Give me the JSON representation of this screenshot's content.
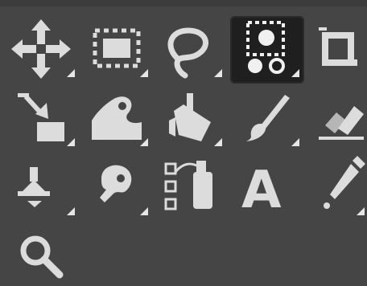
{
  "toolbox": {
    "active_tool": "select-by-color",
    "colors": {
      "background": "#454545",
      "icon": "#dcdcdc",
      "selected_bg": "#1f1f1f"
    },
    "tools": [
      {
        "name": "move",
        "icon": "move-icon",
        "has_group": true
      },
      {
        "name": "rectangle-select",
        "icon": "rectangle-select-icon",
        "has_group": true
      },
      {
        "name": "free-select",
        "icon": "lasso-icon",
        "has_group": true
      },
      {
        "name": "select-by-color",
        "icon": "select-by-color-icon",
        "has_group": true,
        "selected": true
      },
      {
        "name": "crop",
        "icon": "crop-icon",
        "has_group": false
      },
      {
        "name": "unified-transform",
        "icon": "transform-icon",
        "has_group": true
      },
      {
        "name": "warp-transform",
        "icon": "warp-icon",
        "has_group": true
      },
      {
        "name": "bucket-fill",
        "icon": "bucket-fill-icon",
        "has_group": true
      },
      {
        "name": "paintbrush",
        "icon": "paintbrush-icon",
        "has_group": true
      },
      {
        "name": "eraser",
        "icon": "eraser-icon",
        "has_group": true
      },
      {
        "name": "clone",
        "icon": "clone-stamp-icon",
        "has_group": true
      },
      {
        "name": "smudge",
        "icon": "smudge-icon",
        "has_group": true
      },
      {
        "name": "paths",
        "icon": "paths-icon",
        "has_group": false
      },
      {
        "name": "text",
        "icon": "text-icon",
        "has_group": false
      },
      {
        "name": "color-picker",
        "icon": "color-picker-icon",
        "has_group": true
      },
      {
        "name": "zoom",
        "icon": "zoom-icon",
        "has_group": false
      }
    ]
  }
}
